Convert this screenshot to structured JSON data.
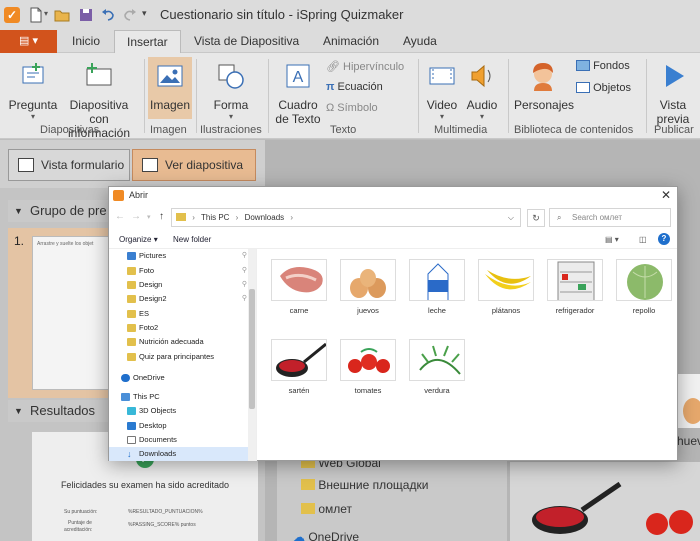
{
  "app": {
    "title": "Cuestionario sin título - iSpring Quizmaker",
    "accent": "#f08a24",
    "file_color": "#d2531c"
  },
  "tabs": [
    "Inicio",
    "Insertar",
    "Vista de Diapositiva",
    "Animación",
    "Ayuda"
  ],
  "active_tab": "Insertar",
  "ribbon": {
    "pregunta": "Pregunta",
    "diapositiva_1": "Diapositiva con",
    "diapositiva_2": "información",
    "imagen": "Imagen",
    "forma": "Forma",
    "cuadro_1": "Cuadro",
    "cuadro_2": "de Texto",
    "hipervinculo": "Hipervínculo",
    "ecuacion": "Ecuación",
    "simbolo": "Símbolo",
    "video": "Video",
    "audio": "Audio",
    "personajes": "Personajes",
    "fondos": "Fondos",
    "objetos": "Objetos",
    "vista_1": "Vista",
    "vista_2": "previa",
    "groups": {
      "diapositivas": "Diapositivas",
      "imagen": "Imagen",
      "ilustraciones": "Ilustraciones",
      "texto": "Texto",
      "multimedia": "Multimedia",
      "biblioteca": "Biblioteca de contenidos",
      "publicar": "Publicar"
    }
  },
  "view": {
    "formulario": "Vista formulario",
    "diapositiva": "Ver diapositiva"
  },
  "left": {
    "group_title": "Grupo de pre",
    "slide_number": "1.",
    "slide_text": "Arrastre y suelte los objet",
    "results_title": "Resultados",
    "congrats": "Felicidades su examen ha sido acreditado",
    "score_label": "Su puntuación:",
    "score_value": "%RESULTADO_PUNTUACION%",
    "pass_label_1": "Puntaje de",
    "pass_label_2": "acreditación:",
    "pass_value": "%PASSING_SCORE% puntos"
  },
  "right": {
    "folder_1": "Web Global",
    "folder_2": "Внешние площадки",
    "folder_3": "омлет",
    "onedrive": "OneDrive",
    "huevo": "huevo"
  },
  "dialog": {
    "title": "Abrir",
    "path": [
      "This PC",
      "Downloads"
    ],
    "search_placeholder": "Search омлет",
    "organize": "Organize",
    "new_folder": "New folder",
    "nav": [
      {
        "label": "Pictures",
        "pinned": true
      },
      {
        "label": "Foto",
        "pinned": true
      },
      {
        "label": "Design",
        "pinned": true
      },
      {
        "label": "Design2",
        "pinned": true
      },
      {
        "label": "ES",
        "pinned": false
      },
      {
        "label": "Foto2",
        "pinned": false
      },
      {
        "label": "Nutrición adecuada",
        "pinned": false
      },
      {
        "label": "Quiz para principantes",
        "pinned": false
      },
      {
        "label": "OneDrive",
        "pinned": false
      },
      {
        "label": "This PC",
        "pinned": false
      },
      {
        "label": "3D Objects",
        "pinned": false
      },
      {
        "label": "Desktop",
        "pinned": false
      },
      {
        "label": "Documents",
        "pinned": false
      },
      {
        "label": "Downloads",
        "pinned": false
      }
    ],
    "files": [
      "carne",
      "juevos",
      "leche",
      "plátanos",
      "refrigerador",
      "repollo",
      "sartén",
      "tomates",
      "verdura"
    ]
  }
}
